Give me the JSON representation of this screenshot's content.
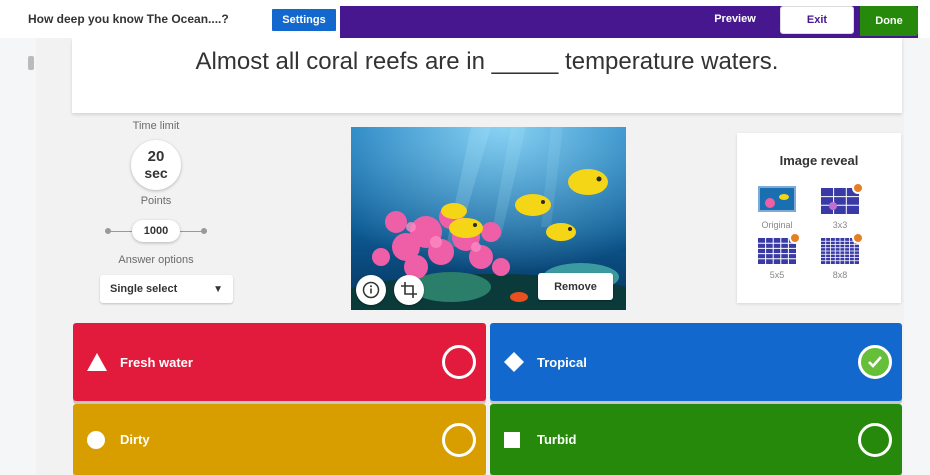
{
  "header": {
    "quiz_title": "How deep you know The Ocean....?",
    "settings_label": "Settings",
    "preview_label": "Preview",
    "exit_label": "Exit",
    "done_label": "Done"
  },
  "question": {
    "text": "Almost all coral reefs are in _____ temperature waters."
  },
  "options_panel": {
    "time_limit_label": "Time limit",
    "time_value": "20",
    "time_unit": "sec",
    "points_label": "Points",
    "points_value": "1000",
    "answer_options_label": "Answer options",
    "answer_options_value": "Single select"
  },
  "image": {
    "remove_label": "Remove",
    "info_icon": "info-icon",
    "crop_icon": "crop-icon"
  },
  "image_reveal": {
    "title": "Image reveal",
    "options": [
      {
        "label": "Original",
        "selected": true
      },
      {
        "label": "3x3",
        "locked": true
      },
      {
        "label": "5x5",
        "locked": true
      },
      {
        "label": "8x8",
        "locked": true
      }
    ]
  },
  "answers": [
    {
      "text": "Fresh water",
      "shape": "triangle",
      "color": "#e21b3c",
      "correct": false
    },
    {
      "text": "Tropical",
      "shape": "diamond",
      "color": "#1368ce",
      "correct": true
    },
    {
      "text": "Dirty",
      "shape": "circle",
      "color": "#d89e00",
      "correct": false
    },
    {
      "text": "Turbid",
      "shape": "square",
      "color": "#26890c",
      "correct": false
    }
  ],
  "colors": {
    "brand_purple": "#46178f",
    "settings_blue": "#1368ce",
    "done_green": "#26890c",
    "correct_green": "#66bf39"
  }
}
